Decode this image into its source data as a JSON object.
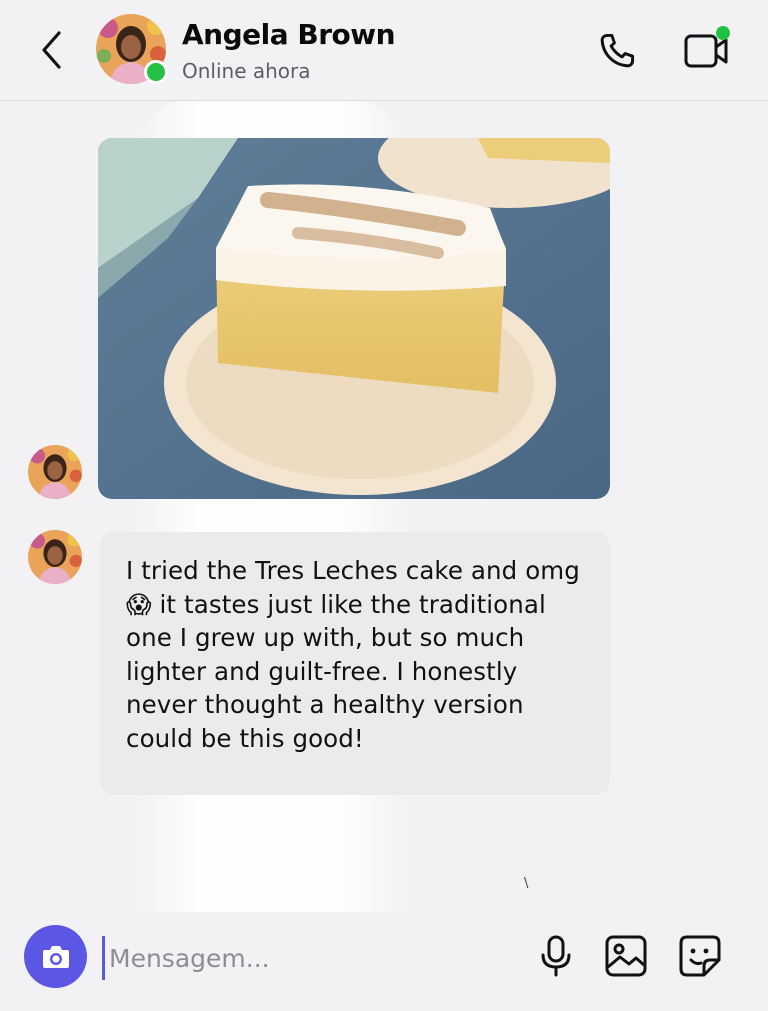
{
  "header": {
    "contact_name": "Angela Brown",
    "status": "Online ahora"
  },
  "messages": [
    {
      "type": "image",
      "description": "Tres Leches cake slice"
    },
    {
      "type": "text",
      "text": "I tried the Tres Leches cake and omg 😱 it tastes just like the traditional one I grew up with, but so much lighter and guilt-free. I honestly never thought a healthy version could be this good!"
    }
  ],
  "composer": {
    "placeholder": "Mensagem..."
  },
  "stray_mark": "\\",
  "colors": {
    "accent": "#5b57e4",
    "online": "#22c043",
    "bubble": "#ebebed",
    "background": "#f2f1f3"
  },
  "icons": [
    "back-arrow-icon",
    "phone-icon",
    "video-call-icon",
    "camera-icon",
    "microphone-icon",
    "gallery-icon",
    "sticker-icon"
  ]
}
